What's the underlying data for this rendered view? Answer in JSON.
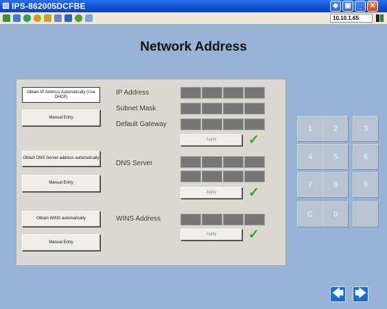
{
  "window": {
    "title": "IPS-862005DCFBE",
    "controls": [
      "◆",
      "▣",
      "_",
      "✕"
    ]
  },
  "toolbar": {
    "ip_address": "10.10.1.65",
    "icons": [
      "network-icon",
      "window-icon",
      "globe-icon",
      "refresh-icon",
      "graph-icon",
      "chart-icon",
      "info-icon",
      "search-icon",
      "settings-icon"
    ]
  },
  "page": {
    "title": "Network Address"
  },
  "ip_section": {
    "obtain_auto_label": "Obtain IP Address Automatically (Use DHCP)",
    "manual_label": "Manual Entry",
    "fields": [
      "IP Address",
      "Subnet Mask",
      "Default Gateway"
    ],
    "apply_label": "Apply"
  },
  "dns_section": {
    "obtain_auto_label": "Obtain DNS Server address automatically",
    "manual_label": "Manual Entry",
    "field": "DNS Server",
    "apply_label": "Apply"
  },
  "wins_section": {
    "obtain_auto_label": "Obtain WINS automatically",
    "manual_label": "Manual Entry",
    "field": "WINS Address",
    "apply_label": "Apply"
  },
  "keypad": [
    "1",
    "2",
    "3",
    "4",
    "5",
    "6",
    "7",
    "8",
    "9",
    "C",
    "0",
    "."
  ],
  "nav": {
    "back": "🡄",
    "forward": "🡆"
  },
  "colors": {
    "check": "#22aa22",
    "accent": "#1a6fd6",
    "field": "#767676"
  }
}
